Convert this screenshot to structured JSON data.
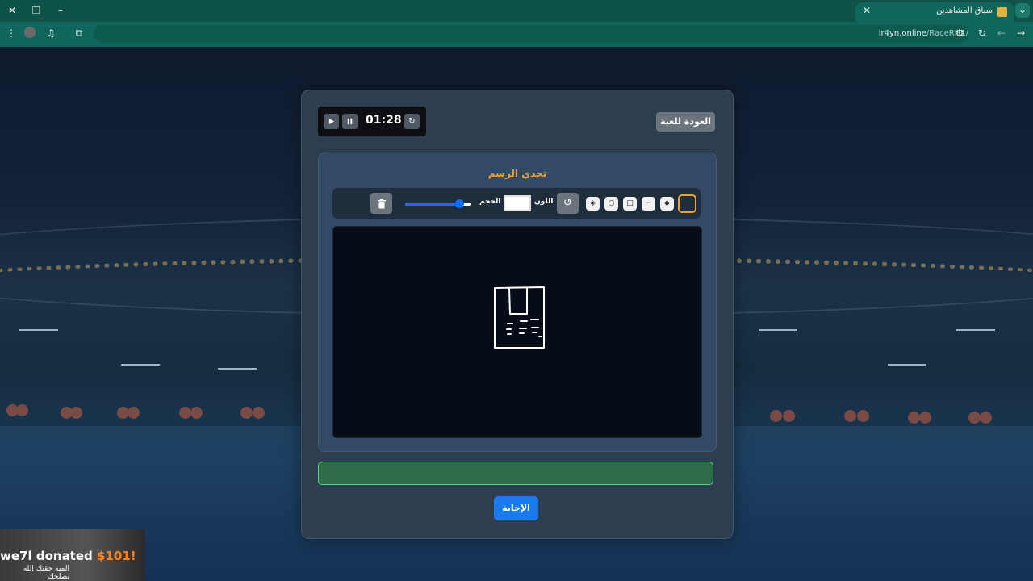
{
  "browser": {
    "tab_title": "سباق المشاهدين",
    "url_host": "ir4yn.online",
    "url_path": "/RaceRH1/",
    "theme_color": "#10665a"
  },
  "timer": {
    "time": "01:28",
    "icons": [
      "play-icon",
      "pause-icon",
      "reset-icon"
    ]
  },
  "header": {
    "back_label": "العودة للعبة"
  },
  "challenge": {
    "title": "تحدي الرسم",
    "toolbar": {
      "tools": [
        "pen",
        "eraser",
        "line",
        "rectangle",
        "circle",
        "fill"
      ],
      "active_tool": "pen",
      "color_label": "اللون",
      "color_value": "#ffffff",
      "size_label": "الحجم",
      "size_level": 0.82
    }
  },
  "answer": {
    "value": "",
    "placeholder": ""
  },
  "submit_label": "الإجابة",
  "donation": {
    "name": "we7l",
    "text": "donated",
    "amount": "$101!",
    "message": "الميه حقتك الله يصلحك"
  },
  "colors": {
    "accent_title": "#f0a030",
    "primary_button": "#1a7bf0",
    "answer_border": "#56d185"
  }
}
